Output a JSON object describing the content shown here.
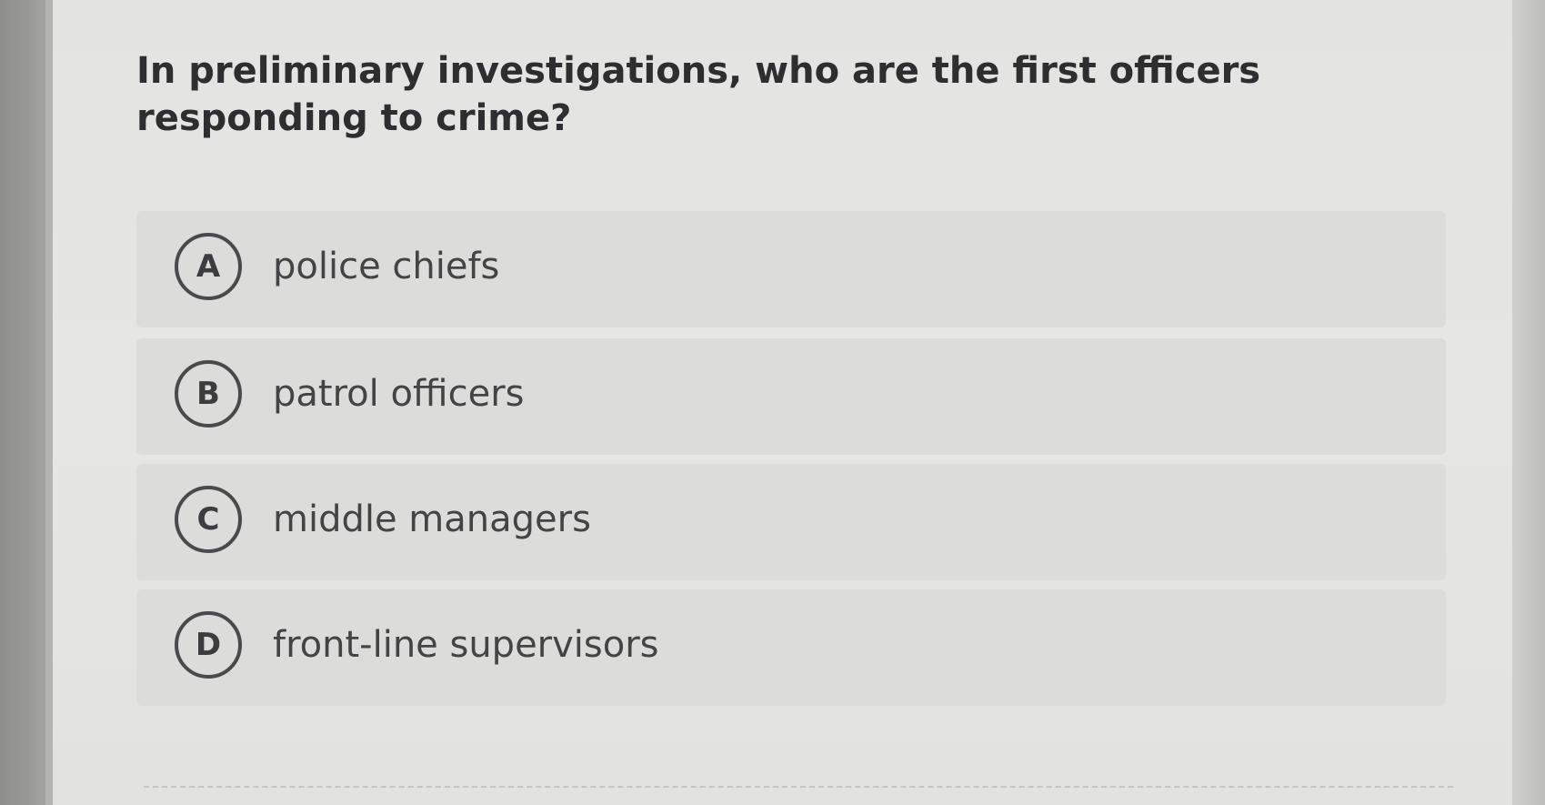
{
  "question": {
    "text": "In preliminary investigations, who are the first officers responding to crime?"
  },
  "options": [
    {
      "letter": "A",
      "text": "police chiefs"
    },
    {
      "letter": "B",
      "text": "patrol officers"
    },
    {
      "letter": "C",
      "text": "middle managers"
    },
    {
      "letter": "D",
      "text": "front-line supervisors"
    }
  ]
}
